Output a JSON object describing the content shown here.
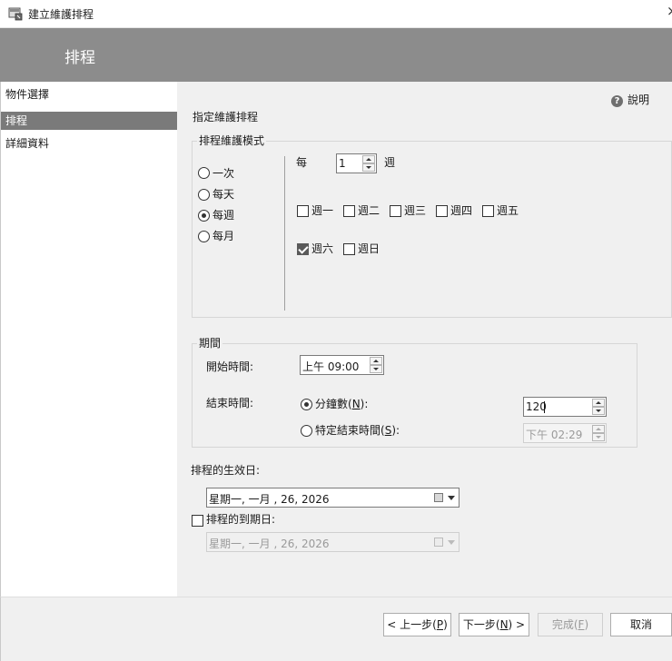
{
  "window": {
    "title": "建立維護排程",
    "close_glyph": "×",
    "icon": "scheduled-task-icon"
  },
  "header": {
    "title": "排程"
  },
  "sidebar": {
    "items": [
      {
        "label": "物件選擇",
        "selected": false
      },
      {
        "label": "排程",
        "selected": true
      },
      {
        "label": "詳細資料",
        "selected": false
      }
    ]
  },
  "help": {
    "icon": "help-icon",
    "glyph": "?",
    "label": "說明"
  },
  "main": {
    "section_title": "指定維護排程",
    "pattern": {
      "legend": "排程維護模式",
      "options": [
        {
          "label": "一次",
          "selected": false
        },
        {
          "label": "每天",
          "selected": false
        },
        {
          "label": "每週",
          "selected": true
        },
        {
          "label": "每月",
          "selected": false
        }
      ],
      "every_label": "每",
      "every_value": "1",
      "every_unit": "週",
      "days": [
        {
          "label": "週一",
          "checked": false
        },
        {
          "label": "週二",
          "checked": false
        },
        {
          "label": "週三",
          "checked": false
        },
        {
          "label": "週四",
          "checked": false
        },
        {
          "label": "週五",
          "checked": false
        },
        {
          "label": "週六",
          "checked": true
        },
        {
          "label": "週日",
          "checked": false
        }
      ]
    },
    "duration": {
      "legend": "期間",
      "start_label": "開始時間:",
      "start_value": "上午 09:00",
      "end_label": "結束時間:",
      "minutes": {
        "label_pre": "分鐘數(",
        "accel": "N",
        "label_post": "):",
        "selected": true,
        "value": "120"
      },
      "specific_end": {
        "label_pre": "特定結束時間(",
        "accel": "S",
        "label_post": "):",
        "selected": false,
        "value": "下午 02:29"
      }
    },
    "effective": {
      "label": "排程的生效日:",
      "value": "星期一, 一月 , 26, 2026"
    },
    "expiry": {
      "label": "排程的到期日:",
      "checked": false,
      "value": "星期一, 一月 , 26, 2026"
    }
  },
  "footer": {
    "back": {
      "pre": "< 上一步(",
      "accel": "P",
      "post": ")"
    },
    "next": {
      "pre": "下一步(",
      "accel": "N",
      "post": ") >"
    },
    "finish": {
      "pre": "完成(",
      "accel": "F",
      "post": ")"
    },
    "cancel": {
      "label": "取消"
    }
  }
}
